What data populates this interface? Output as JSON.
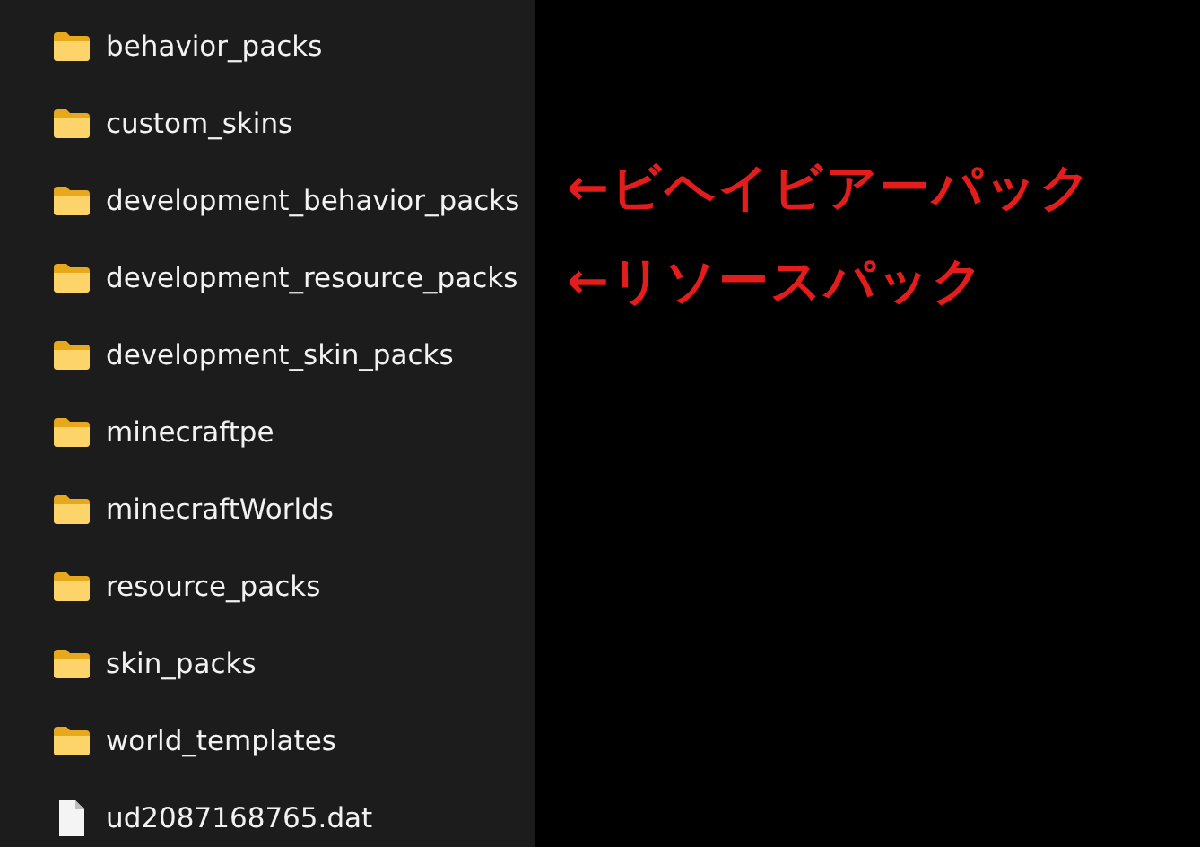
{
  "files": [
    {
      "name": "behavior_packs",
      "kind": "folder"
    },
    {
      "name": "custom_skins",
      "kind": "folder"
    },
    {
      "name": "development_behavior_packs",
      "kind": "folder"
    },
    {
      "name": "development_resource_packs",
      "kind": "folder"
    },
    {
      "name": "development_skin_packs",
      "kind": "folder"
    },
    {
      "name": "minecraftpe",
      "kind": "folder"
    },
    {
      "name": "minecraftWorlds",
      "kind": "folder"
    },
    {
      "name": "resource_packs",
      "kind": "folder"
    },
    {
      "name": "skin_packs",
      "kind": "folder"
    },
    {
      "name": "world_templates",
      "kind": "folder"
    },
    {
      "name": "ud2087168765.dat",
      "kind": "file"
    }
  ],
  "annotations": [
    "←ビヘイビアーパック",
    "←リソースパック"
  ]
}
